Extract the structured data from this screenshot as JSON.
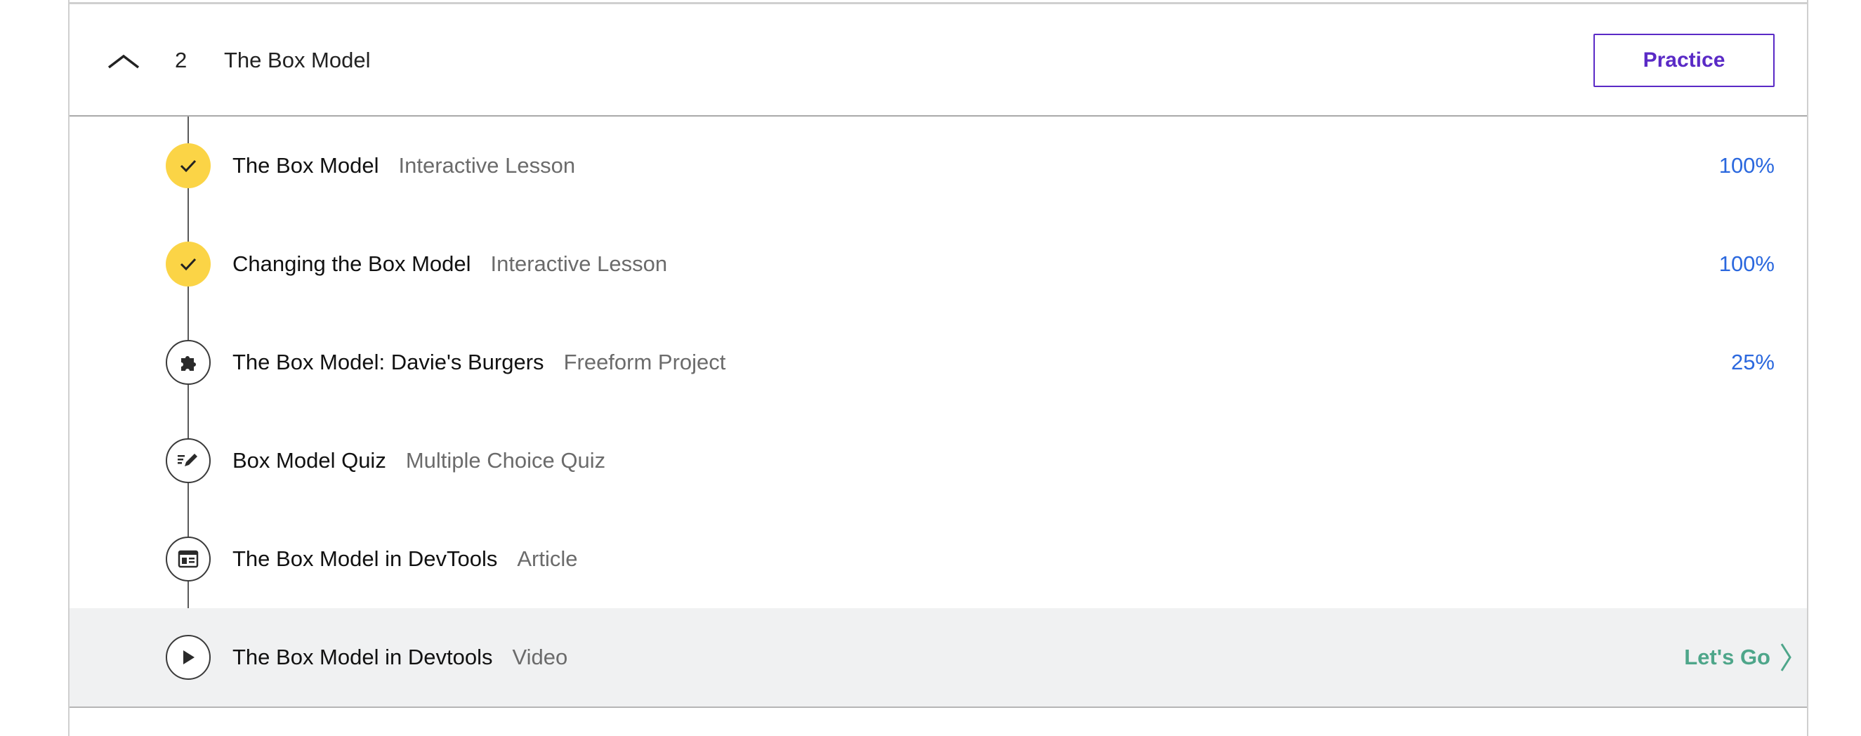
{
  "module": {
    "number": "2",
    "title": "The Box Model",
    "practice_label": "Practice"
  },
  "lessons": [
    {
      "title": "The Box Model",
      "type": "Interactive Lesson",
      "progress": "100%",
      "status": "complete",
      "icon": "check-icon"
    },
    {
      "title": "Changing the Box Model",
      "type": "Interactive Lesson",
      "progress": "100%",
      "status": "complete",
      "icon": "check-icon"
    },
    {
      "title": "The Box Model: Davie's Burgers",
      "type": "Freeform Project",
      "progress": "25%",
      "status": "in-progress",
      "icon": "puzzle-icon"
    },
    {
      "title": "Box Model Quiz",
      "type": "Multiple Choice Quiz",
      "progress": "",
      "status": "not-started",
      "icon": "quiz-pencil-icon"
    },
    {
      "title": "The Box Model in DevTools",
      "type": "Article",
      "progress": "",
      "status": "not-started",
      "icon": "article-icon"
    },
    {
      "title": "The Box Model in Devtools",
      "type": "Video",
      "progress": "",
      "status": "current",
      "icon": "play-icon",
      "action_label": "Let's Go"
    }
  ],
  "colors": {
    "accent_purple": "#5a2ac6",
    "progress_blue": "#2b68de",
    "complete_yellow": "#fbd446",
    "action_green": "#4ea68a",
    "highlight_row": "#f0f1f2"
  }
}
